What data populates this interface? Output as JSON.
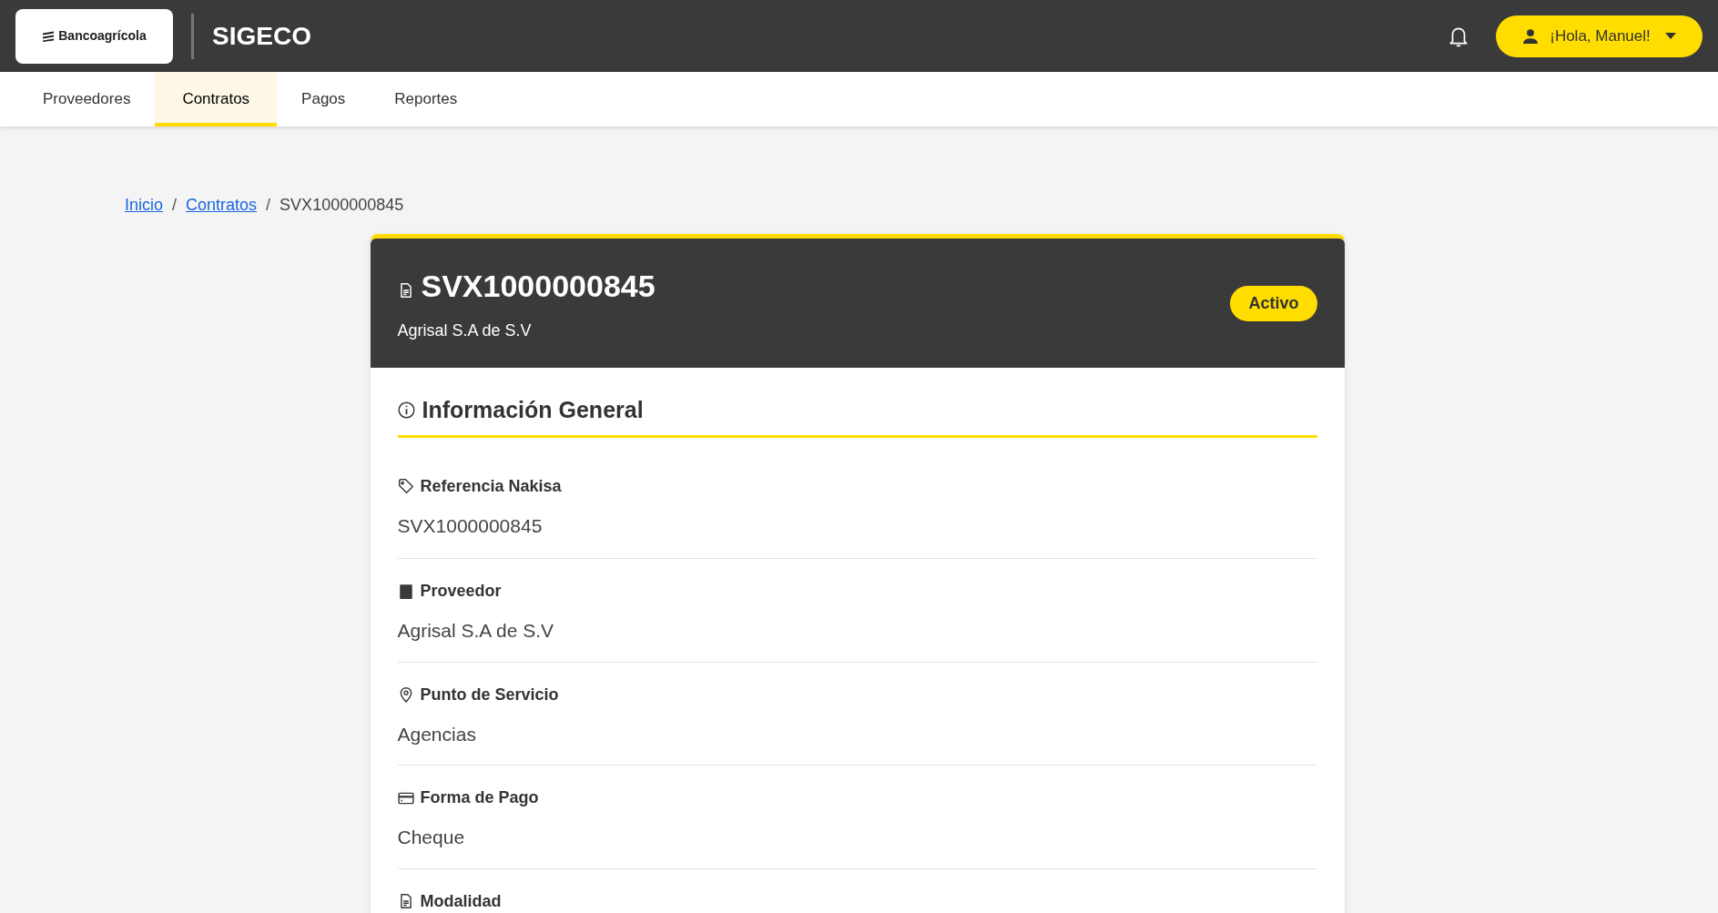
{
  "header": {
    "logo": "Bancoagrícola",
    "app_title": "SIGECO",
    "user_button": "¡Hola, Manuel!"
  },
  "nav": [
    {
      "label": "Proveedores",
      "selected": false
    },
    {
      "label": "Contratos",
      "selected": true
    },
    {
      "label": "Pagos",
      "selected": false
    },
    {
      "label": "Reportes",
      "selected": false
    }
  ],
  "breadcrumb": {
    "links": [
      "Inicio",
      "Contratos"
    ],
    "separators": [
      "/",
      "/"
    ],
    "current": "SVX1000000845"
  },
  "contract": {
    "title": "SVX1000000845",
    "subtitle": "Agrisal S.A de S.V",
    "status": "Activo"
  },
  "section": {
    "title": "Información General"
  },
  "fields": [
    {
      "kind": "tag",
      "label": "Referencia Nakisa",
      "value": "SVX1000000845"
    },
    {
      "kind": "building",
      "label": "Proveedor",
      "value": "Agrisal S.A de S.V"
    },
    {
      "kind": "pin",
      "label": "Punto de Servicio",
      "value": "Agencias"
    },
    {
      "kind": "card",
      "label": "Forma de Pago",
      "value": "Cheque"
    },
    {
      "kind": "document",
      "label": "Modalidad"
    }
  ]
}
